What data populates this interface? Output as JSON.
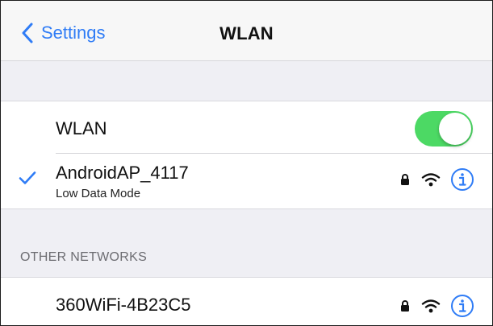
{
  "nav": {
    "back_label": "Settings",
    "title": "WLAN"
  },
  "wlan_toggle": {
    "label": "WLAN",
    "on": true,
    "color": "#4cd964"
  },
  "connected_network": {
    "name": "AndroidAP_4117",
    "subtitle": "Low Data Mode",
    "selected_icon": "checkmark-icon",
    "icons": [
      "lock-icon",
      "wifi-icon",
      "info-icon"
    ]
  },
  "other_networks": {
    "header": "OTHER NETWORKS",
    "items": [
      {
        "name": "360WiFi-4B23C5",
        "icons": [
          "lock-icon",
          "wifi-icon",
          "info-icon"
        ]
      }
    ]
  },
  "colors": {
    "accent": "#2f7cf6",
    "background": "#efeff4",
    "toggle_on": "#4cd964"
  }
}
